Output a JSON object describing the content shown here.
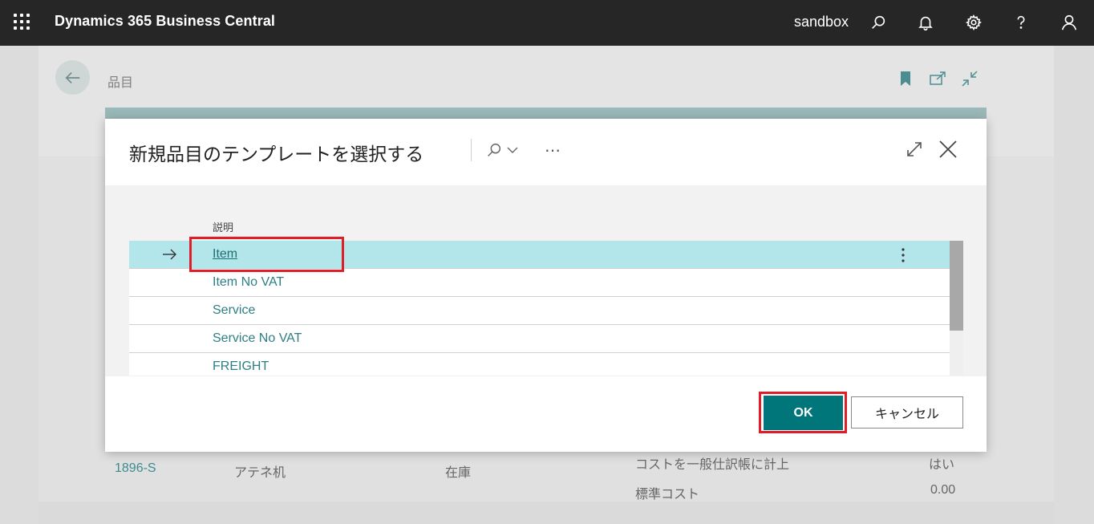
{
  "topbar": {
    "app_title": "Dynamics 365 Business Central",
    "environment": "sandbox",
    "icons": [
      "app-launcher-icon",
      "search-icon",
      "bell-icon",
      "gear-icon",
      "help-icon",
      "user-icon"
    ]
  },
  "page": {
    "breadcrumb": "品目",
    "icons": [
      "back-arrow-icon",
      "bookmark-icon",
      "open-new-window-icon",
      "collapse-icon"
    ],
    "background_row": {
      "number": "1896-S",
      "description": "アテネ机",
      "type": "在庫"
    },
    "background_fields": [
      {
        "label": "コストを一般仕訳帳に計上",
        "value": "はい"
      },
      {
        "label": "標準コスト",
        "value": "0.00"
      }
    ]
  },
  "dialog": {
    "title": "新規品目のテンプレートを選択する",
    "more": "…",
    "column_header": "説明",
    "rows": [
      {
        "description": "Item",
        "selected": true
      },
      {
        "description": "Item No VAT",
        "selected": false
      },
      {
        "description": "Service",
        "selected": false
      },
      {
        "description": "Service No VAT",
        "selected": false
      },
      {
        "description": "FREIGHT",
        "selected": false
      }
    ],
    "ok_label": "OK",
    "cancel_label": "キャンセル",
    "colors": {
      "accent": "#00767a",
      "selected_row": "#b3e6ea",
      "highlight": "#e01e28",
      "link": "#2e7f84"
    }
  }
}
